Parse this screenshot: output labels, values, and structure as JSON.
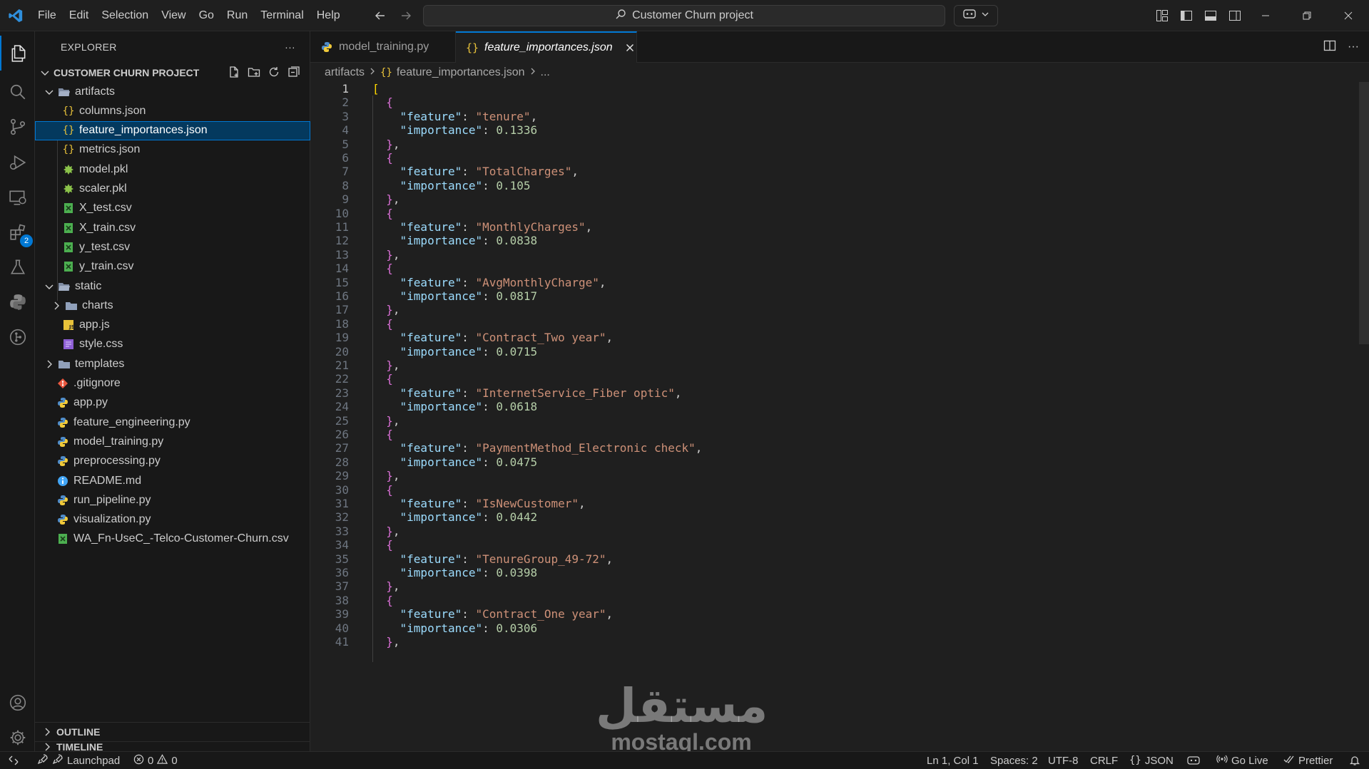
{
  "menu": [
    "File",
    "Edit",
    "Selection",
    "View",
    "Go",
    "Run",
    "Terminal",
    "Help"
  ],
  "search": {
    "text": "Customer Churn project"
  },
  "explorer": {
    "title": "EXPLORER",
    "more": "···",
    "project": "CUSTOMER CHURN PROJECT",
    "items": [
      {
        "label": "artifacts",
        "type": "folder-open",
        "level": 1
      },
      {
        "label": "columns.json",
        "type": "json",
        "level": 2
      },
      {
        "label": "feature_importances.json",
        "type": "json",
        "level": 2,
        "selected": true
      },
      {
        "label": "metrics.json",
        "type": "json",
        "level": 2
      },
      {
        "label": "model.pkl",
        "type": "pkl",
        "level": 2
      },
      {
        "label": "scaler.pkl",
        "type": "pkl",
        "level": 2
      },
      {
        "label": "X_test.csv",
        "type": "csv",
        "level": 2
      },
      {
        "label": "X_train.csv",
        "type": "csv",
        "level": 2
      },
      {
        "label": "y_test.csv",
        "type": "csv",
        "level": 2
      },
      {
        "label": "y_train.csv",
        "type": "csv",
        "level": 2
      },
      {
        "label": "static",
        "type": "folder-open",
        "level": 1
      },
      {
        "label": "charts",
        "type": "folder",
        "level": 2
      },
      {
        "label": "app.js",
        "type": "js",
        "level": 2
      },
      {
        "label": "style.css",
        "type": "css",
        "level": 2
      },
      {
        "label": "templates",
        "type": "folder",
        "level": 1
      },
      {
        "label": ".gitignore",
        "type": "git",
        "level": 1
      },
      {
        "label": "app.py",
        "type": "py",
        "level": 1
      },
      {
        "label": "feature_engineering.py",
        "type": "py",
        "level": 1
      },
      {
        "label": "model_training.py",
        "type": "py",
        "level": 1
      },
      {
        "label": "preprocessing.py",
        "type": "py",
        "level": 1
      },
      {
        "label": "README.md",
        "type": "md",
        "level": 1
      },
      {
        "label": "run_pipeline.py",
        "type": "py",
        "level": 1
      },
      {
        "label": "visualization.py",
        "type": "py",
        "level": 1
      },
      {
        "label": "WA_Fn-UseC_-Telco-Customer-Churn.csv",
        "type": "csv",
        "level": 1
      }
    ],
    "outline": "OUTLINE",
    "timeline": "TIMELINE"
  },
  "activity": {
    "extensions_badge": "2"
  },
  "tabs": [
    {
      "label": "model_training.py",
      "active": false
    },
    {
      "label": "feature_importances.json",
      "active": true
    }
  ],
  "breadcrumb": [
    "artifacts",
    "feature_importances.json",
    "..."
  ],
  "code": {
    "current_line": 1,
    "entries": [
      {
        "feature": "tenure",
        "importance": "0.1336"
      },
      {
        "feature": "TotalCharges",
        "importance": "0.105"
      },
      {
        "feature": "MonthlyCharges",
        "importance": "0.0838"
      },
      {
        "feature": "AvgMonthlyCharge",
        "importance": "0.0817"
      },
      {
        "feature": "Contract_Two year",
        "importance": "0.0715"
      },
      {
        "feature": "InternetService_Fiber optic",
        "importance": "0.0618"
      },
      {
        "feature": "PaymentMethod_Electronic check",
        "importance": "0.0475"
      },
      {
        "feature": "IsNewCustomer",
        "importance": "0.0442"
      },
      {
        "feature": "TenureGroup_49-72",
        "importance": "0.0398"
      },
      {
        "feature": "Contract_One year",
        "importance": "0.0306"
      }
    ]
  },
  "watermark": {
    "arabic": "مستقل",
    "latin": "mostaql.com"
  },
  "status": {
    "launchpad": "Launchpad",
    "errors": "0",
    "warnings": "0",
    "position": "Ln 1, Col 1",
    "spaces": "Spaces: 2",
    "encoding": "UTF-8",
    "eol": "CRLF",
    "language": "JSON",
    "golive": "Go Live",
    "prettier": "Prettier"
  }
}
